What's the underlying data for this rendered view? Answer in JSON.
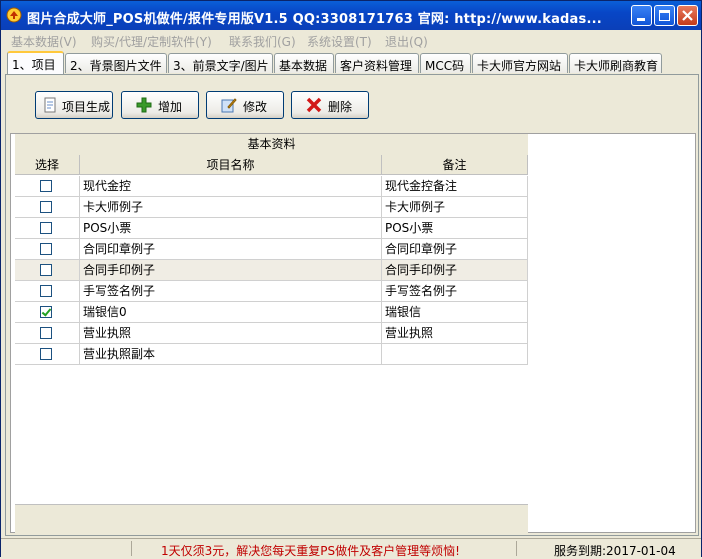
{
  "window": {
    "title": "图片合成大师_POS机做件/报件专用版V1.5   QQ:3308171763 官网: http://www.kadas..."
  },
  "menu": [
    "基本数据(V)",
    "购买/代理/定制软件(Y)",
    "联系我们(G)",
    "系统设置(T)",
    "退出(Q)"
  ],
  "tabs": [
    "1、项目",
    "2、背景图片文件",
    "3、前景文字/图片",
    "基本数据",
    "客户资料管理",
    "MCC码",
    "卡大师官方网站",
    "卡大师刷商教育"
  ],
  "toolbar": {
    "generate_label": "项目生成",
    "add_label": "增加",
    "edit_label": "修改",
    "delete_label": "删除"
  },
  "grid": {
    "group_header": "基本资料",
    "columns": [
      "选择",
      "项目名称",
      "备注"
    ],
    "rows": [
      {
        "checked": false,
        "name": "现代金控",
        "note": "现代金控备注"
      },
      {
        "checked": false,
        "name": "卡大师例子",
        "note": "卡大师例子"
      },
      {
        "checked": false,
        "name": "POS小票",
        "note": "POS小票"
      },
      {
        "checked": false,
        "name": "合同印章例子",
        "note": "合同印章例子"
      },
      {
        "checked": false,
        "name": "合同手印例子",
        "note": "合同手印例子"
      },
      {
        "checked": false,
        "name": "手写签名例子",
        "note": "手写签名例子"
      },
      {
        "checked": true,
        "name": "瑞银信0",
        "note": "瑞银信"
      },
      {
        "checked": false,
        "name": "营业执照",
        "note": "营业执照"
      },
      {
        "checked": false,
        "name": "营业执照副本",
        "note": ""
      }
    ]
  },
  "status": {
    "message": "1天仅须3元，解决您每天重复PS做件及客户管理等烦恼!",
    "expiry": "服务到期:2017-01-04"
  },
  "colors": {
    "title_bar": "#0846c6",
    "status_message": "#c00000",
    "check": "#21a121"
  }
}
